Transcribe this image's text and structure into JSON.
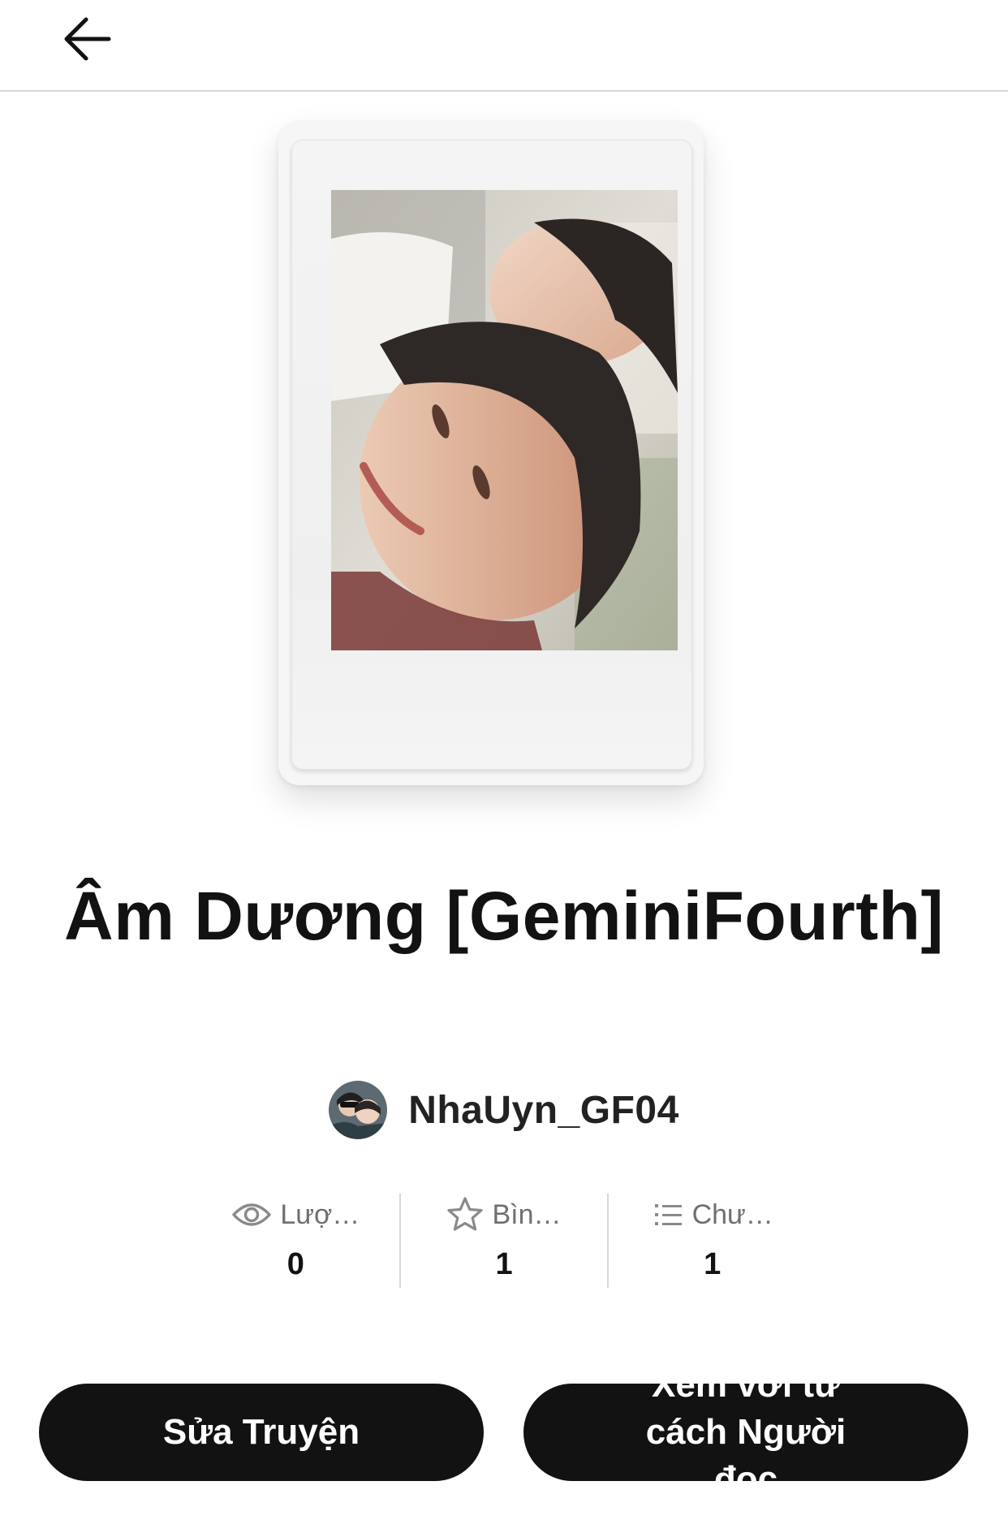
{
  "header": {
    "back_icon": "arrow-left-icon"
  },
  "story": {
    "title": "Âm Dương [GeminiFourth]",
    "cover": "polaroid-photo-cover"
  },
  "author": {
    "name": "NhaUyn_GF04",
    "avatar": "author-avatar"
  },
  "stats": [
    {
      "icon": "eye-icon",
      "label": "Lượ…",
      "value": "0"
    },
    {
      "icon": "star-icon",
      "label": "Bìn…",
      "value": "1"
    },
    {
      "icon": "list-icon",
      "label": "Chư…",
      "value": "1"
    }
  ],
  "actions": {
    "edit_label": "Sửa Truyện",
    "reader_label": "Xem với tư cách Người đọc"
  },
  "colors": {
    "button_bg": "#121212",
    "text": "#121212",
    "muted": "#6f6f6f",
    "divider": "#d6d6d6"
  }
}
